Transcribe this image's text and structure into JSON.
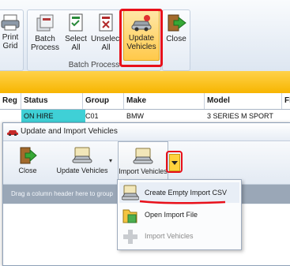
{
  "ribbon": {
    "print_grid": "Print\nGrid",
    "batch_process": "Batch\nProcess",
    "select_all": "Select\nAll",
    "unselect_all": "Unselect\nAll",
    "update_vehicles": "Update\nVehicles",
    "close": "Close",
    "group_label": "Batch Process"
  },
  "grid": {
    "columns": [
      "Reg",
      "Status",
      "Group",
      "Make",
      "Model",
      "Fl"
    ],
    "partial_row": [
      "",
      "ON HIRE",
      "C01",
      "BMW",
      "3 SERIES M SPORT",
      ""
    ]
  },
  "dialog": {
    "title": "Update and Import Vehicles",
    "toolbar": {
      "close": "Close",
      "update_vehicles": "Update Vehicles",
      "import_vehicles": "Import Vehicles"
    },
    "group_hint": "Drag a column header here to group"
  },
  "menu": {
    "items": [
      {
        "label": "Create Empty Import CSV",
        "enabled": true
      },
      {
        "label": "Open Import File",
        "enabled": true
      },
      {
        "label": "Import Vehicles",
        "enabled": false
      }
    ]
  },
  "colors": {
    "annotation_red": "#e8101a",
    "stripe_yellow": "#ffc21a",
    "accent_blue": "#2a62b5"
  },
  "icons": [
    "printer-icon",
    "batch-process-icon",
    "select-all-icon",
    "unselect-all-icon",
    "update-vehicles-icon",
    "close-exit-icon",
    "car-icon",
    "csv-create-icon",
    "open-file-icon",
    "import-plus-icon",
    "dropdown-arrow-icon"
  ]
}
